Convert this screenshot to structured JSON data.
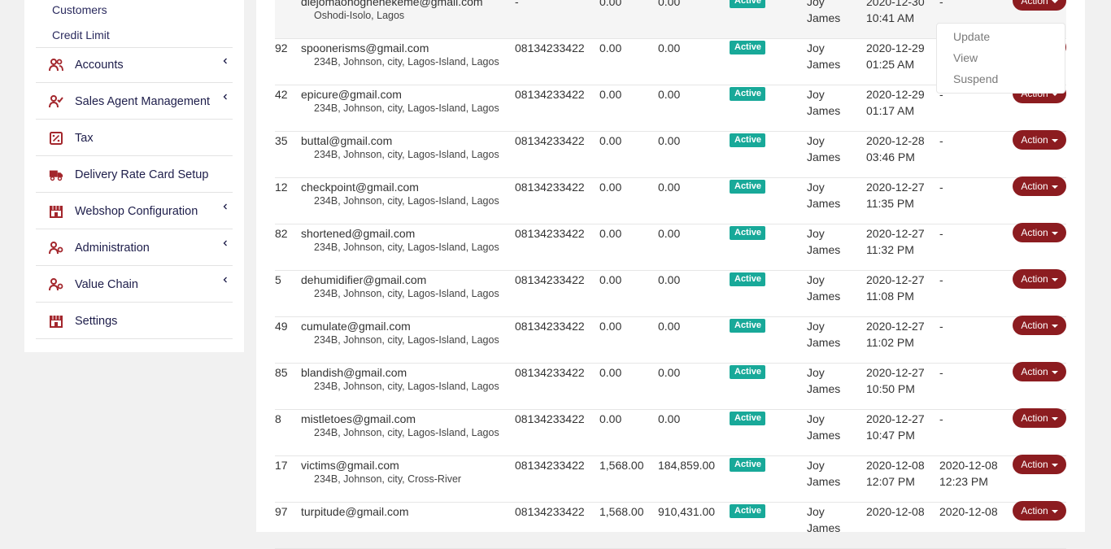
{
  "sidebar": {
    "sub_items": [
      {
        "label": "Customers"
      },
      {
        "label": "Credit Limit"
      }
    ],
    "items": [
      {
        "label": "Accounts",
        "icon": "users-icon",
        "has_chevron": true
      },
      {
        "label": "Sales Agent Management",
        "icon": "user-check-icon",
        "has_chevron": true
      },
      {
        "label": "Tax",
        "icon": "percent-icon",
        "has_chevron": false
      },
      {
        "label": "Delivery Rate Card Setup",
        "icon": "truck-icon",
        "has_chevron": false
      },
      {
        "label": "Webshop Configuration",
        "icon": "store-icon",
        "has_chevron": true
      },
      {
        "label": "Administration",
        "icon": "user-gear-icon",
        "has_chevron": true
      },
      {
        "label": "Value Chain",
        "icon": "user-gear-icon",
        "has_chevron": true
      },
      {
        "label": "Settings",
        "icon": "store-icon",
        "has_chevron": false
      }
    ]
  },
  "colors": {
    "accent": "#8c1c20",
    "status_active": "#18a999",
    "nav_icon": "#a3262c"
  },
  "table": {
    "rows": [
      {
        "id": "",
        "email": "diejomaohoghenekeme@gmail.com",
        "address": "Oshodi-Isolo, Lagos",
        "phone": "-",
        "amount1": "0.00",
        "amount2": "0.00",
        "status": "Active",
        "agent_first": "Joy",
        "agent_last": "James",
        "created_date": "2020-12-30",
        "created_time": "10:41 AM",
        "updated_date": "-",
        "updated_time": "",
        "action": "Action"
      },
      {
        "id": "92",
        "email": "spoonerisms@gmail.com",
        "address": "234B, Johnson, city, Lagos-Island, Lagos",
        "phone": "08134233422",
        "amount1": "0.00",
        "amount2": "0.00",
        "status": "Active",
        "agent_first": "Joy",
        "agent_last": "James",
        "created_date": "2020-12-29",
        "created_time": "01:25 AM",
        "updated_date": "",
        "updated_time": "",
        "action": "Action"
      },
      {
        "id": "42",
        "email": "epicure@gmail.com",
        "address": "234B, Johnson, city, Lagos-Island, Lagos",
        "phone": "08134233422",
        "amount1": "0.00",
        "amount2": "0.00",
        "status": "Active",
        "agent_first": "Joy",
        "agent_last": "James",
        "created_date": "2020-12-29",
        "created_time": "01:17 AM",
        "updated_date": "-",
        "updated_time": "",
        "action": "Action"
      },
      {
        "id": "35",
        "email": "buttal@gmail.com",
        "address": "234B, Johnson, city, Lagos-Island, Lagos",
        "phone": "08134233422",
        "amount1": "0.00",
        "amount2": "0.00",
        "status": "Active",
        "agent_first": "Joy",
        "agent_last": "James",
        "created_date": "2020-12-28",
        "created_time": "03:46 PM",
        "updated_date": "-",
        "updated_time": "",
        "action": "Action"
      },
      {
        "id": "12",
        "email": "checkpoint@gmail.com",
        "address": "234B, Johnson, city, Lagos-Island, Lagos",
        "phone": "08134233422",
        "amount1": "0.00",
        "amount2": "0.00",
        "status": "Active",
        "agent_first": "Joy",
        "agent_last": "James",
        "created_date": "2020-12-27",
        "created_time": "11:35 PM",
        "updated_date": "-",
        "updated_time": "",
        "action": "Action"
      },
      {
        "id": "82",
        "email": "shortened@gmail.com",
        "address": "234B, Johnson, city, Lagos-Island, Lagos",
        "phone": "08134233422",
        "amount1": "0.00",
        "amount2": "0.00",
        "status": "Active",
        "agent_first": "Joy",
        "agent_last": "James",
        "created_date": "2020-12-27",
        "created_time": "11:32 PM",
        "updated_date": "-",
        "updated_time": "",
        "action": "Action"
      },
      {
        "id": "5",
        "email": "dehumidifier@gmail.com",
        "address": "234B, Johnson, city, Lagos-Island, Lagos",
        "phone": "08134233422",
        "amount1": "0.00",
        "amount2": "0.00",
        "status": "Active",
        "agent_first": "Joy",
        "agent_last": "James",
        "created_date": "2020-12-27",
        "created_time": "11:08 PM",
        "updated_date": "-",
        "updated_time": "",
        "action": "Action"
      },
      {
        "id": "49",
        "email": "cumulate@gmail.com",
        "address": "234B, Johnson, city, Lagos-Island, Lagos",
        "phone": "08134233422",
        "amount1": "0.00",
        "amount2": "0.00",
        "status": "Active",
        "agent_first": "Joy",
        "agent_last": "James",
        "created_date": "2020-12-27",
        "created_time": "11:02 PM",
        "updated_date": "-",
        "updated_time": "",
        "action": "Action"
      },
      {
        "id": "85",
        "email": "blandish@gmail.com",
        "address": "234B, Johnson, city, Lagos-Island, Lagos",
        "phone": "08134233422",
        "amount1": "0.00",
        "amount2": "0.00",
        "status": "Active",
        "agent_first": "Joy",
        "agent_last": "James",
        "created_date": "2020-12-27",
        "created_time": "10:50 PM",
        "updated_date": "-",
        "updated_time": "",
        "action": "Action"
      },
      {
        "id": "8",
        "email": "mistletoes@gmail.com",
        "address": "234B, Johnson, city, Lagos-Island, Lagos",
        "phone": "08134233422",
        "amount1": "0.00",
        "amount2": "0.00",
        "status": "Active",
        "agent_first": "Joy",
        "agent_last": "James",
        "created_date": "2020-12-27",
        "created_time": "10:47 PM",
        "updated_date": "-",
        "updated_time": "",
        "action": "Action"
      },
      {
        "id": "17",
        "email": "victims@gmail.com",
        "address": "234B, Johnson, city, Cross-River",
        "phone": "08134233422",
        "amount1": "1,568.00",
        "amount2": "184,859.00",
        "status": "Active",
        "agent_first": "Joy",
        "agent_last": "James",
        "created_date": "2020-12-08",
        "created_time": "12:07 PM",
        "updated_date": "2020-12-08",
        "updated_time": "12:23 PM",
        "action": "Action"
      },
      {
        "id": "97",
        "email": "turpitude@gmail.com",
        "address": "",
        "phone": "08134233422",
        "amount1": "1,568.00",
        "amount2": "910,431.00",
        "status": "Active",
        "agent_first": "Joy",
        "agent_last": "James",
        "created_date": "2020-12-08",
        "created_time": "",
        "updated_date": "2020-12-08",
        "updated_time": "",
        "action": "Action"
      }
    ]
  },
  "dropdown": {
    "items": [
      {
        "label": "Update"
      },
      {
        "label": "View"
      },
      {
        "label": "Suspend"
      }
    ]
  }
}
